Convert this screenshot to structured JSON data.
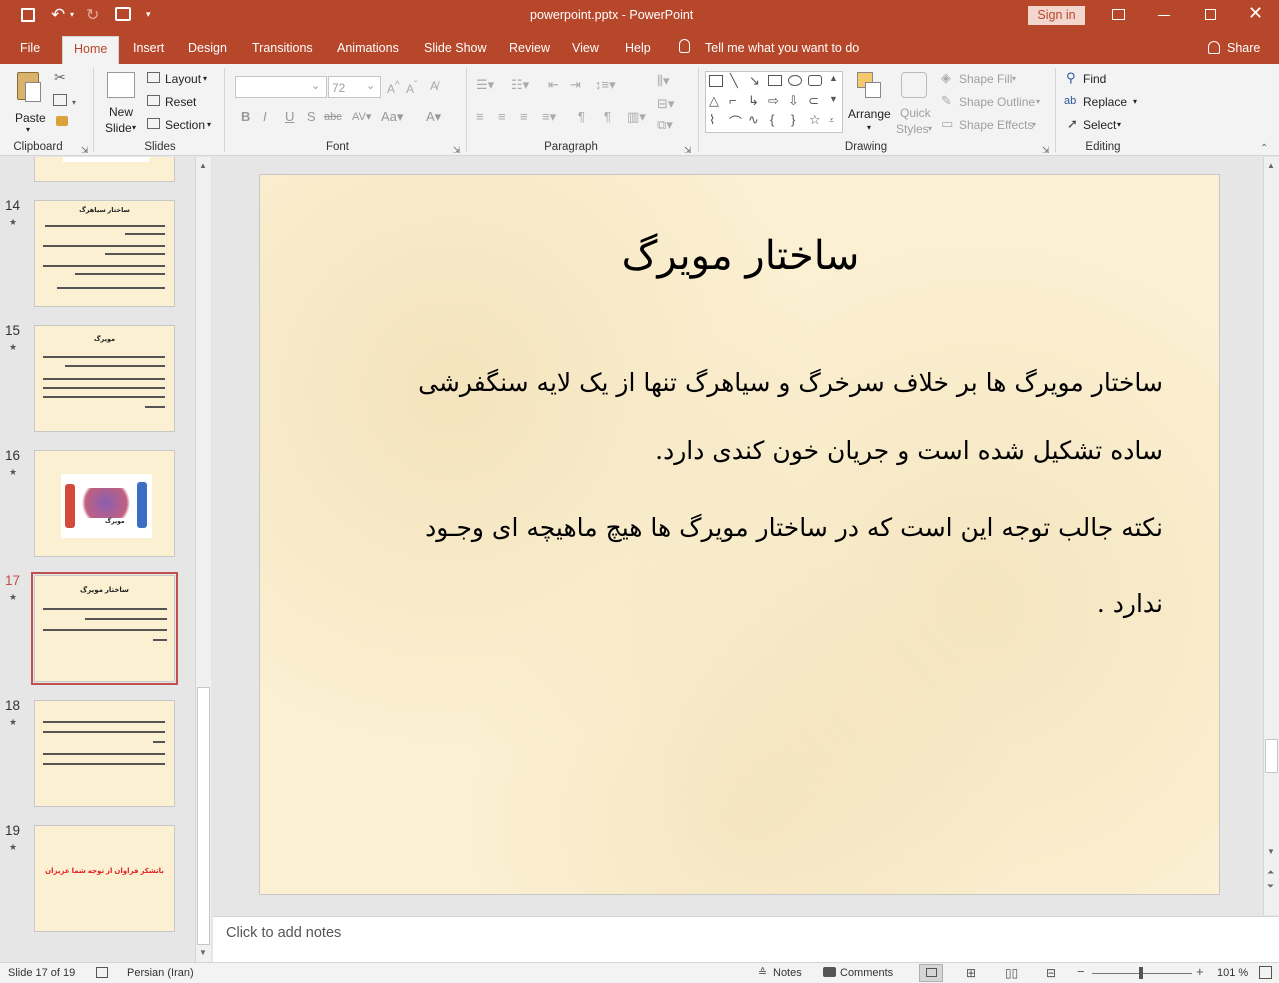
{
  "titlebar": {
    "title": "powerpoint.pptx  -  PowerPoint",
    "sign_in": "Sign in"
  },
  "tabs": [
    "File",
    "Home",
    "Insert",
    "Design",
    "Transitions",
    "Animations",
    "Slide Show",
    "Review",
    "View",
    "Help"
  ],
  "tell_me": "Tell me what you want to do",
  "share": "Share",
  "ribbon": {
    "clipboard": {
      "paste": "Paste",
      "label": "Clipboard"
    },
    "slides": {
      "new_slide_1": "New",
      "new_slide_2": "Slide",
      "layout": "Layout",
      "reset": "Reset",
      "section": "Section",
      "label": "Slides"
    },
    "font": {
      "font_name": "",
      "font_size": "72",
      "label": "Font"
    },
    "paragraph": {
      "label": "Paragraph"
    },
    "drawing": {
      "arrange": "Arrange",
      "quick_styles_1": "Quick",
      "quick_styles_2": "Styles",
      "shape_fill": "Shape Fill",
      "shape_outline": "Shape Outline",
      "shape_effects": "Shape Effects",
      "label": "Drawing"
    },
    "editing": {
      "find": "Find",
      "replace": "Replace",
      "select": "Select",
      "label": "Editing"
    }
  },
  "thumbnails": [
    {
      "num": "14",
      "title": "ساختار سیاهرگ"
    },
    {
      "num": "15",
      "title": "مویرگ"
    },
    {
      "num": "16",
      "title": "مویرگ"
    },
    {
      "num": "17",
      "title": "ساختار مویرگ"
    },
    {
      "num": "18",
      "title": ""
    },
    {
      "num": "19",
      "title": "باتشکر فراوان از توجه شما عزیزان"
    }
  ],
  "slide": {
    "title": "ساختار مویرگ",
    "line1": "ساختار مویرگ ها بر خلاف سرخرگ و سیاهرگ تنها از یک لایه سنگفرشی",
    "line2": "ساده تشکیل شده است و جریان خون کندی دارد.",
    "line3": "نکته جالب توجه این است که در ساختار مویرگ ها هیچ ماهیچه ای وجـود",
    "line4": "ندارد ."
  },
  "notes_placeholder": "Click to add notes",
  "status": {
    "slide_of": "Slide 17 of 19",
    "language": "Persian (Iran)",
    "notes": "Notes",
    "comments": "Comments",
    "zoom": "101 %"
  },
  "colors": {
    "accent": "#b7472a",
    "slide_bg": "#fbf0d2",
    "selected_thumb": "#c0504d"
  }
}
